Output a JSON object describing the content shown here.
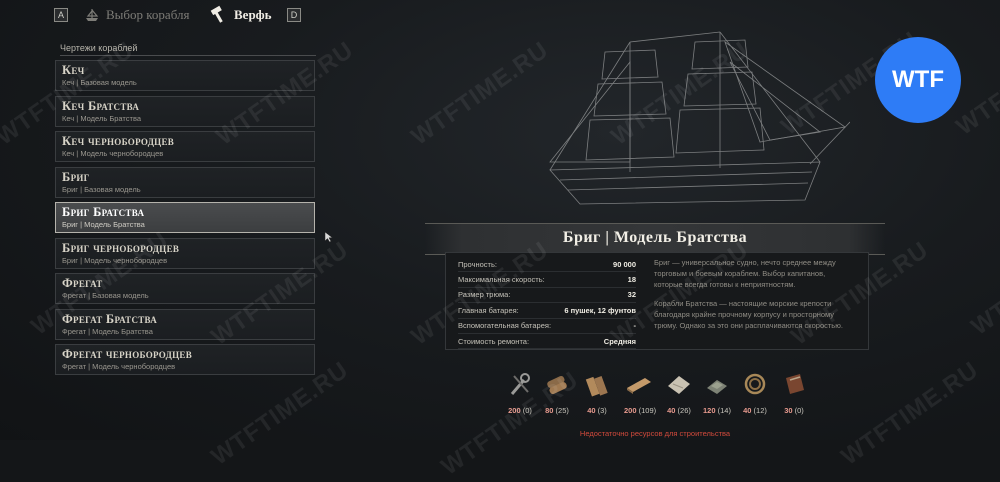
{
  "nav": {
    "left_key": "A",
    "right_key": "D",
    "tabs": [
      {
        "label": "Выбор корабля",
        "icon": "ship-select-icon",
        "active": false
      },
      {
        "label": "Верфь",
        "icon": "hammer-icon",
        "active": true
      }
    ]
  },
  "blueprints": {
    "header": "Чертежи кораблей",
    "items": [
      {
        "title": "Кеч",
        "subtitle": "Кеч | Базовая модель",
        "selected": false
      },
      {
        "title": "Кеч Братства",
        "subtitle": "Кеч | Модель Братства",
        "selected": false
      },
      {
        "title": "Кеч чернобородцев",
        "subtitle": "Кеч | Модель чернобородцев",
        "selected": false
      },
      {
        "title": "Бриг",
        "subtitle": "Бриг | Базовая модель",
        "selected": false
      },
      {
        "title": "Бриг Братства",
        "subtitle": "Бриг | Модель Братства",
        "selected": true
      },
      {
        "title": "Бриг чернобородцев",
        "subtitle": "Бриг | Модель чернобородцев",
        "selected": false
      },
      {
        "title": "Фрегат",
        "subtitle": "Фрегат | Базовая модель",
        "selected": false
      },
      {
        "title": "Фрегат Братства",
        "subtitle": "Фрегат | Модель Братства",
        "selected": false
      },
      {
        "title": "Фрегат чернобородцев",
        "subtitle": "Фрегат | Модель чернобородцев",
        "selected": false
      }
    ]
  },
  "details": {
    "title": "Бриг | Модель Братства",
    "stats": [
      {
        "label": "Прочность:",
        "value": "90 000"
      },
      {
        "label": "Максимальная скорость:",
        "value": "18"
      },
      {
        "label": "Размер трюма:",
        "value": "32"
      },
      {
        "label": "Главная батарея:",
        "value": "6 пушек, 12 фунтов"
      },
      {
        "label": "Вспомогательная батарея:",
        "value": "-"
      },
      {
        "label": "Стоимость ремонта:",
        "value": "Средняя"
      }
    ],
    "description": [
      "Бриг — универсальное судно, нечто среднее между торговым и боевым кораблем. Выбор капитанов, которые всегда готовы к неприятностям.",
      "Корабли Братства — настоящие морские крепости благодаря крайне прочному корпусу и просторному трюму. Однако за это они расплачиваются скоростью."
    ]
  },
  "resources": [
    {
      "icon": "tools-icon",
      "need": "200",
      "have": "(0)"
    },
    {
      "icon": "logs-icon",
      "need": "80",
      "have": "(25)"
    },
    {
      "icon": "timber-icon",
      "need": "40",
      "have": "(3)"
    },
    {
      "icon": "planks-icon",
      "need": "200",
      "have": "(109)"
    },
    {
      "icon": "cloth-icon",
      "need": "40",
      "have": "(26)"
    },
    {
      "icon": "metal-ingot-icon",
      "need": "120",
      "have": "(14)"
    },
    {
      "icon": "rope-icon",
      "need": "40",
      "have": "(12)"
    },
    {
      "icon": "leather-icon",
      "need": "30",
      "have": "(0)"
    }
  ],
  "warning": "Недостаточно ресурсов для строительства",
  "watermark": "WTFTIME.RU",
  "badge": "WTF",
  "colors": {
    "accent_badge": "#2e7cf6",
    "warning": "#d24a3c",
    "need": "#e79a8e"
  }
}
